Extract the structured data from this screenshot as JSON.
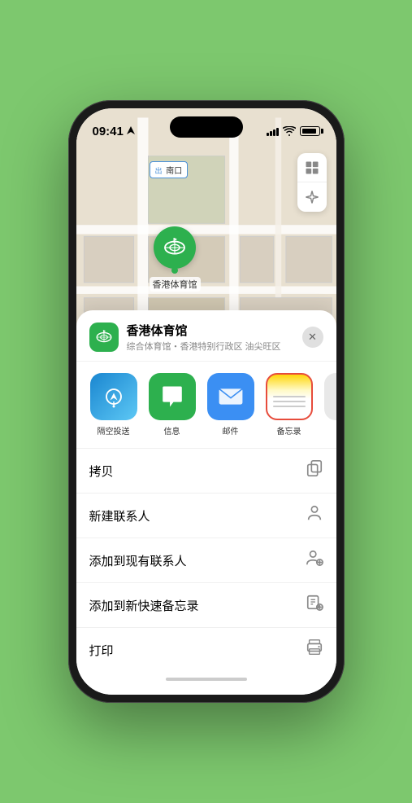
{
  "status": {
    "time": "09:41",
    "location_arrow": "▶"
  },
  "map": {
    "label": "南口"
  },
  "venue": {
    "name": "香港体育馆",
    "subtitle": "综合体育馆・香港特别行政区 油尖旺区",
    "pin_label": "香港体育馆"
  },
  "share_items": [
    {
      "id": "airdrop",
      "label": "隔空投送",
      "type": "airdrop"
    },
    {
      "id": "messages",
      "label": "信息",
      "type": "messages"
    },
    {
      "id": "mail",
      "label": "邮件",
      "type": "mail"
    },
    {
      "id": "notes",
      "label": "备忘录",
      "type": "notes"
    }
  ],
  "actions": [
    {
      "id": "copy",
      "label": "拷贝",
      "icon": "copy"
    },
    {
      "id": "new-contact",
      "label": "新建联系人",
      "icon": "person"
    },
    {
      "id": "add-existing",
      "label": "添加到现有联系人",
      "icon": "person-add"
    },
    {
      "id": "add-notes",
      "label": "添加到新快速备忘录",
      "icon": "notes-add"
    },
    {
      "id": "print",
      "label": "打印",
      "icon": "print"
    }
  ]
}
